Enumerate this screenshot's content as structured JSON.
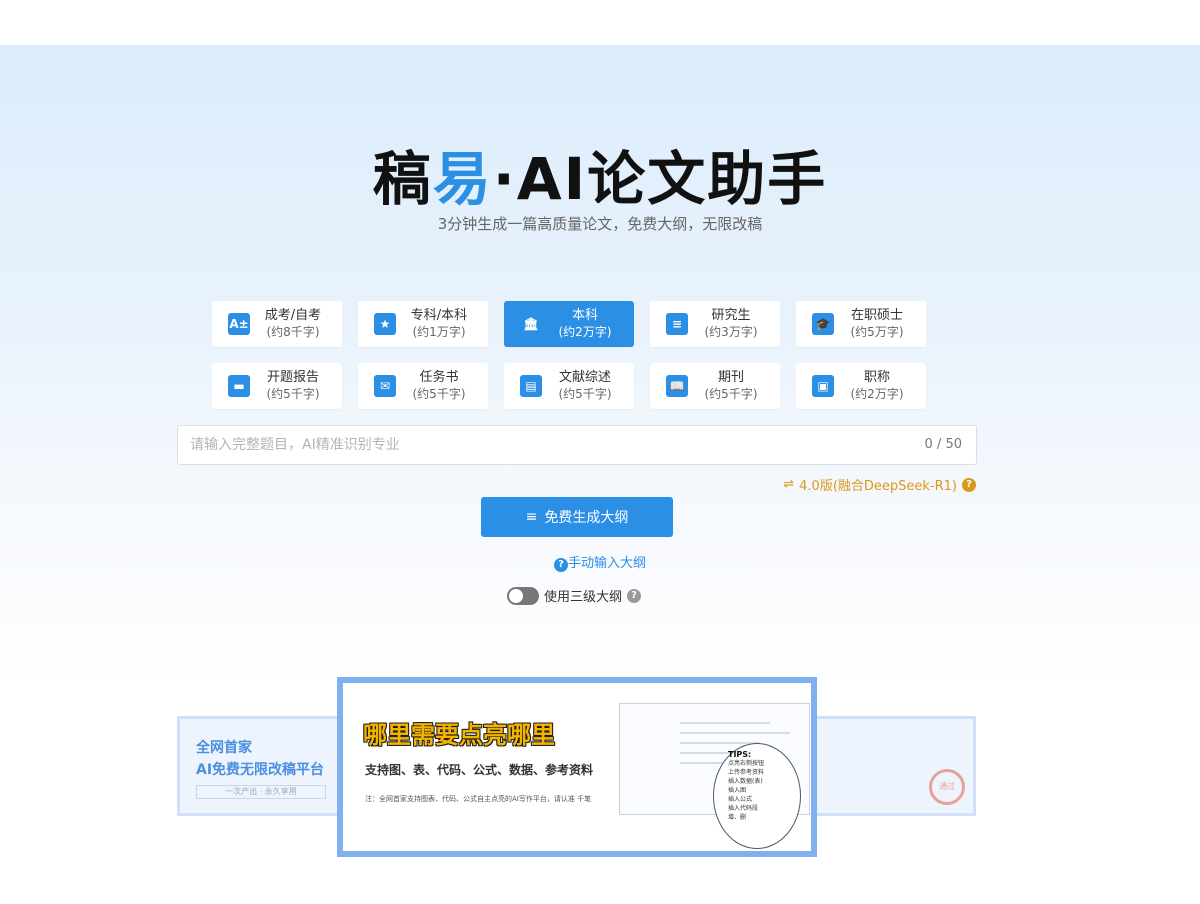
{
  "brand": {
    "name_part1": "稿",
    "name_part2": "易",
    "name_sep": "·",
    "name_part3": "AI论文助手",
    "subtitle": "3分钟生成一篇高质量论文，免费大纲，无限改稿"
  },
  "categories": [
    {
      "label": "成考/自考",
      "words": "(约8千字)",
      "icon": "exam-icon",
      "glyph": "A±",
      "active": false
    },
    {
      "label": "专科/本科",
      "words": "(约1万字)",
      "icon": "star-book-icon",
      "glyph": "★",
      "active": false
    },
    {
      "label": "本科",
      "words": "(约2万字)",
      "icon": "institution-icon",
      "glyph": "🏛",
      "active": true
    },
    {
      "label": "研究生",
      "words": "(约3万字)",
      "icon": "clipboard-icon",
      "glyph": "≡",
      "active": false
    },
    {
      "label": "在职硕士",
      "words": "(约5万字)",
      "icon": "graduate-icon",
      "glyph": "🎓",
      "active": false
    },
    {
      "label": "开题报告",
      "words": "(约5千字)",
      "icon": "report-clipboard-icon",
      "glyph": "▬",
      "active": false
    },
    {
      "label": "任务书",
      "words": "(约5千字)",
      "icon": "envelope-icon",
      "glyph": "✉",
      "active": false
    },
    {
      "label": "文献综述",
      "words": "(约5千字)",
      "icon": "document-icon",
      "glyph": "▤",
      "active": false
    },
    {
      "label": "期刊",
      "words": "(约5千字)",
      "icon": "open-book-icon",
      "glyph": "📖",
      "active": false
    },
    {
      "label": "职称",
      "words": "(约2万字)",
      "icon": "briefcase-icon",
      "glyph": "▣",
      "active": false
    }
  ],
  "title_input": {
    "placeholder": "请输入完整题目，AI精准识别专业",
    "value": "",
    "counter": "0 / 50"
  },
  "version": {
    "label": "4.0版(融合DeepSeek-R1)",
    "switch_glyph": "⇌",
    "help_glyph": "?"
  },
  "generate_button": {
    "label": "免费生成大纲",
    "icon_glyph": "≡"
  },
  "manual_outline": {
    "label": "手动输入大纲",
    "help_glyph": "?"
  },
  "three_level": {
    "label": "使用三级大纲",
    "enabled": false,
    "help_glyph": "?"
  },
  "banners": {
    "left": {
      "line1": "全网首家",
      "line2": "AI免费无限改稿平台",
      "line3": "一次产出 · 永久享用"
    },
    "main": {
      "headline": "哪里需要点亮哪里",
      "subline": "支持图、表、代码、公式、数据、参考资料",
      "note": "注：全网首家支持图表、代码、公式自主点亮的AI写作平台，请认准 千笔",
      "tips_title": "TIPS:",
      "tips": [
        "点亮右侧按钮",
        "上传参考资料",
        "插入数据(表)",
        "插入图",
        "插入公式",
        "插入代码段",
        "增、删"
      ]
    },
    "right": {
      "stamp": "通过"
    }
  }
}
